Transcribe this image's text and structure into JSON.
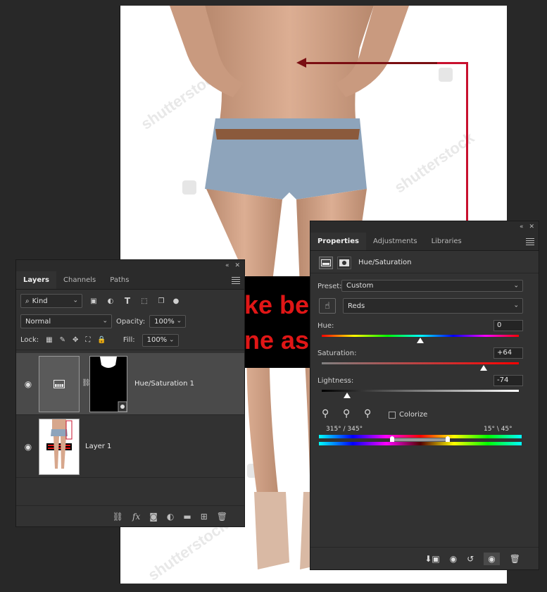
{
  "canvas": {
    "watermark_text": "shutterstock",
    "banner_line1": "ke be",
    "banner_line2": "ne as"
  },
  "layers_panel": {
    "tabs": [
      "Layers",
      "Channels",
      "Paths"
    ],
    "active_tab": "Layers",
    "filter_kind": "Kind",
    "blend_mode": "Normal",
    "opacity_label": "Opacity:",
    "opacity_value": "100%",
    "lock_label": "Lock:",
    "fill_label": "Fill:",
    "fill_value": "100%",
    "layers": [
      {
        "name": "Hue/Saturation 1",
        "type": "adjustment",
        "selected": true,
        "visible": true
      },
      {
        "name": "Layer 1",
        "type": "pixel",
        "selected": false,
        "visible": true
      }
    ],
    "footer_icons": [
      "link-icon",
      "fx-icon",
      "mask-icon",
      "adjustment-icon",
      "folder-icon",
      "new-layer-icon",
      "trash-icon"
    ]
  },
  "properties_panel": {
    "tabs": [
      "Properties",
      "Adjustments",
      "Libraries"
    ],
    "active_tab": "Properties",
    "title": "Hue/Saturation",
    "preset_label": "Preset:",
    "preset_value": "Custom",
    "channel_value": "Reds",
    "hue_label": "Hue:",
    "hue_value": "0",
    "saturation_label": "Saturation:",
    "saturation_value": "+64",
    "lightness_label": "Lightness:",
    "lightness_value": "-74",
    "colorize_label": "Colorize",
    "colorize_checked": false,
    "range_left": "315° / 345°",
    "range_right": "15° \\ 45°",
    "slider_positions": {
      "hue": 0.5,
      "saturation": 0.82,
      "lightness": 0.13
    },
    "footer_icons": [
      "clip-icon",
      "view-previous-icon",
      "reset-icon",
      "visibility-icon",
      "trash-icon"
    ]
  },
  "colors": {
    "panel_bg": "#323232",
    "selected_layer": "#4a4a4a",
    "red_annotation": "#c8102e",
    "banner_text": "#e01616"
  }
}
